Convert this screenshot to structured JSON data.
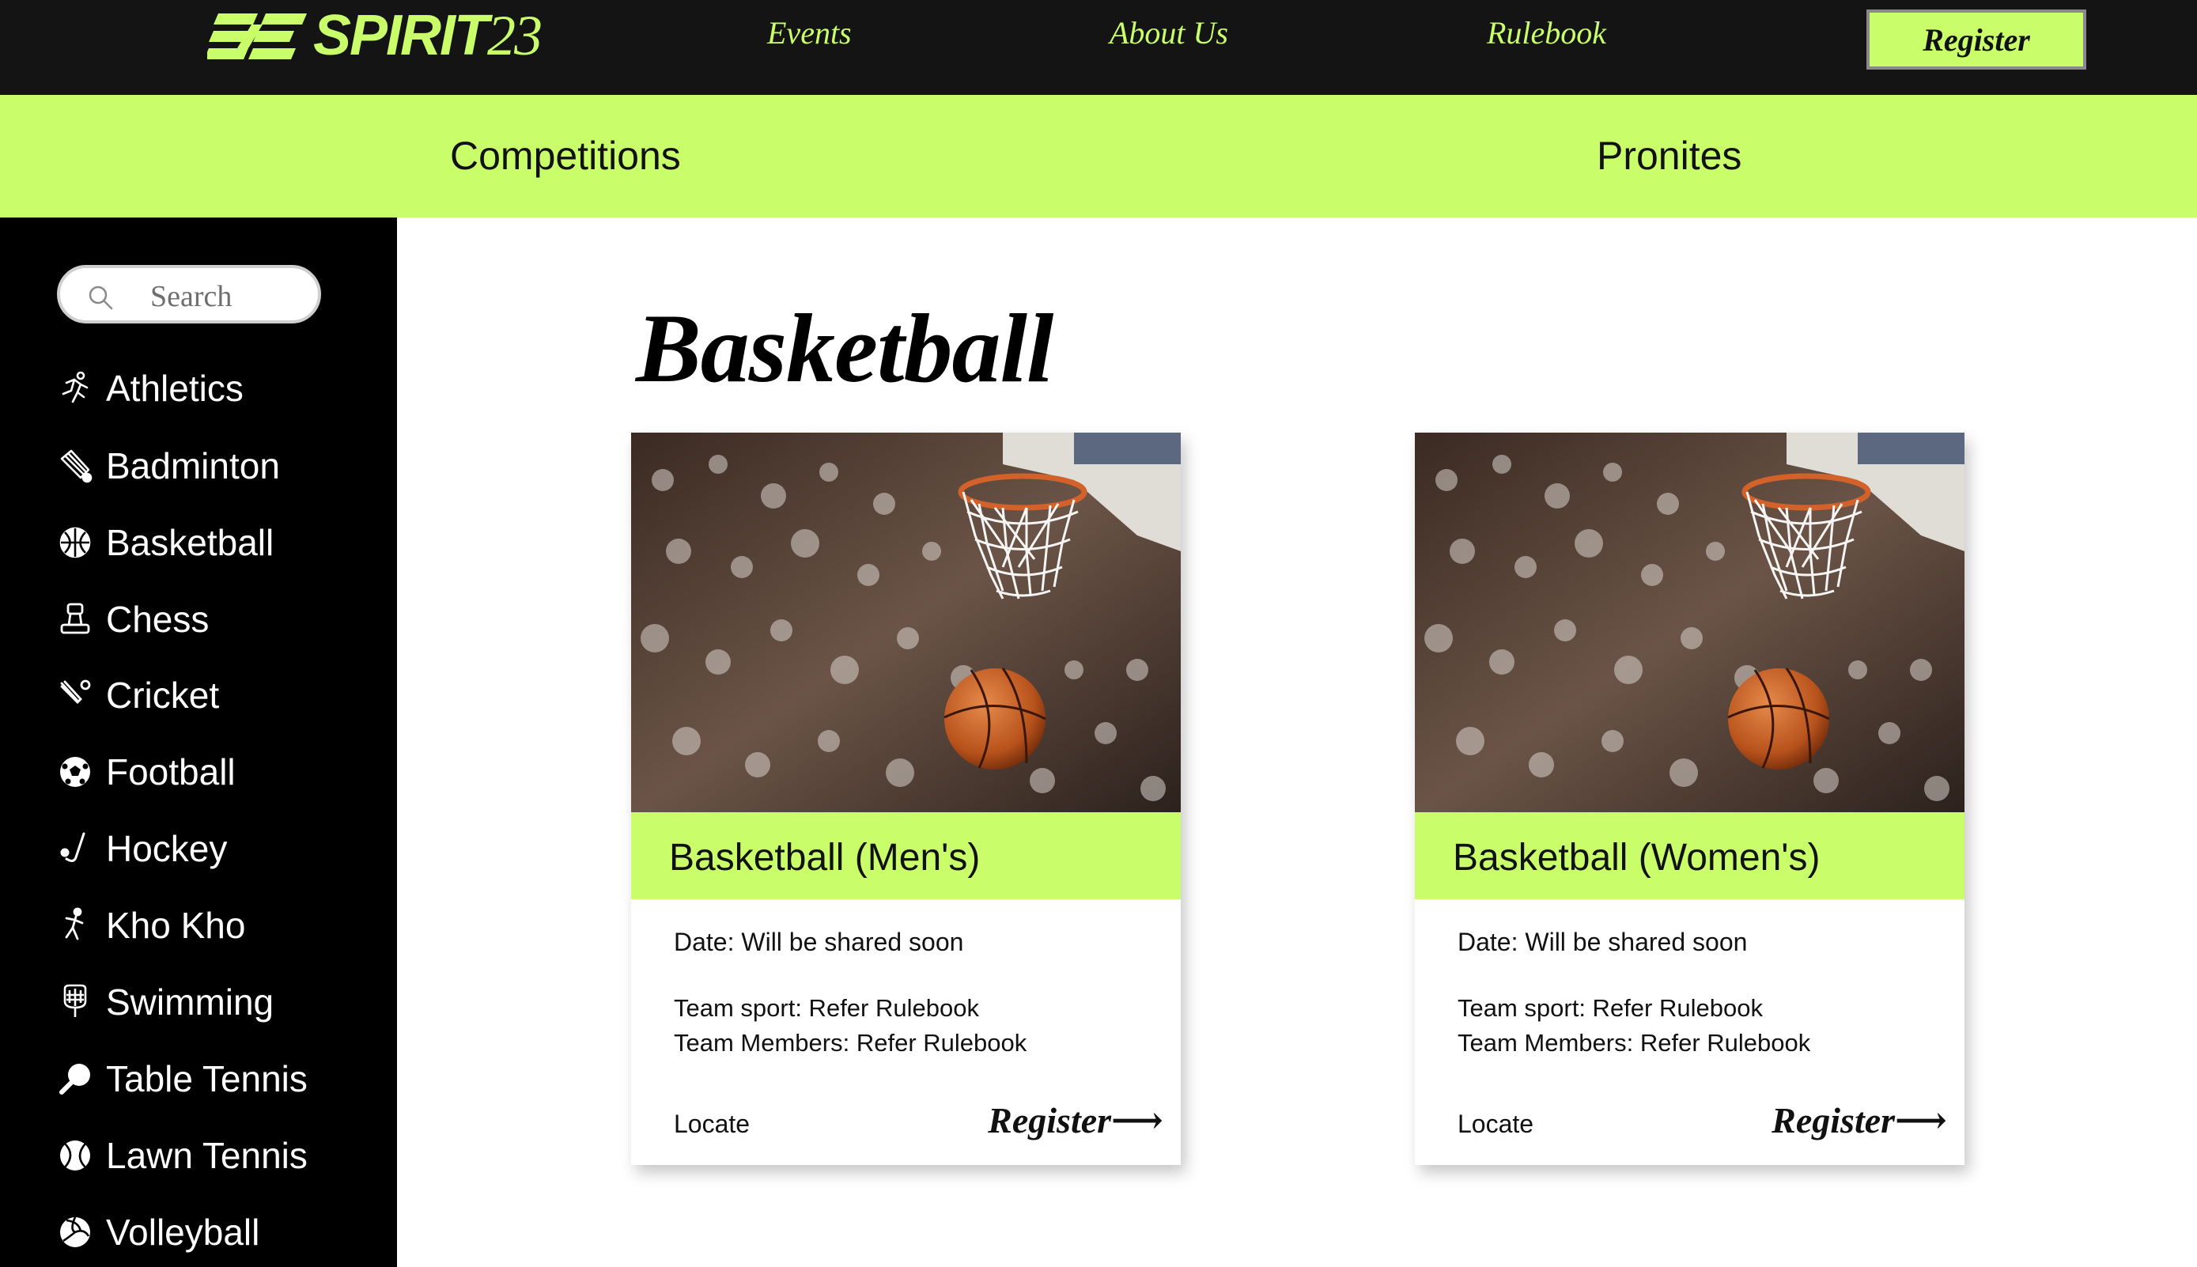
{
  "brand": {
    "logo_text": "SPIRIT",
    "logo_number": "23",
    "accent": "#c9fd6a",
    "dark": "#141414"
  },
  "nav": {
    "events": "Events",
    "about": "About Us",
    "rulebook": "Rulebook",
    "register": "Register"
  },
  "tabs": {
    "competitions": "Competitions",
    "pronites": "Pronites"
  },
  "sidebar": {
    "search_placeholder": "Search",
    "items": [
      {
        "label": "Athletics",
        "icon": "running-icon"
      },
      {
        "label": "Badminton",
        "icon": "shuttlecock-icon"
      },
      {
        "label": "Basketball",
        "icon": "basketball-icon"
      },
      {
        "label": "Chess",
        "icon": "chess-icon"
      },
      {
        "label": "Cricket",
        "icon": "cricket-icon"
      },
      {
        "label": "Football",
        "icon": "football-icon"
      },
      {
        "label": "Hockey",
        "icon": "hockey-icon"
      },
      {
        "label": "Kho Kho",
        "icon": "kho-kho-icon"
      },
      {
        "label": "Swimming",
        "icon": "swimming-icon"
      },
      {
        "label": "Table Tennis",
        "icon": "table-tennis-icon"
      },
      {
        "label": "Lawn Tennis",
        "icon": "tennis-ball-icon"
      },
      {
        "label": "Volleyball",
        "icon": "volleyball-icon"
      }
    ]
  },
  "main": {
    "title": "Basketball",
    "cards": [
      {
        "title": "Basketball (Men's)",
        "date": "Date: Will be shared soon",
        "line1": "Team sport: Refer Rulebook",
        "line2": "Team Members: Refer Rulebook",
        "locate": "Locate",
        "register": "Register⟶"
      },
      {
        "title": "Basketball (Women's)",
        "date": "Date: Will be shared soon",
        "line1": "Team sport: Refer Rulebook",
        "line2": "Team Members: Refer Rulebook",
        "locate": "Locate",
        "register": "Register⟶"
      }
    ]
  }
}
